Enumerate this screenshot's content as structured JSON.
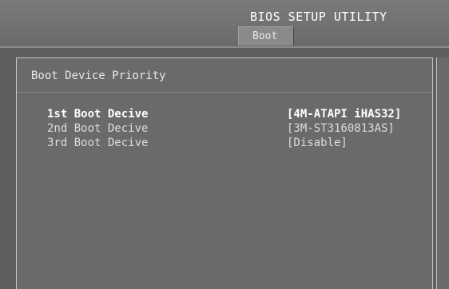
{
  "header": {
    "title": "BIOS SETUP UTILITY",
    "active_tab": "Boot"
  },
  "section": {
    "title": "Boot Device Priority"
  },
  "boot_devices": [
    {
      "label": "1st Boot Decive",
      "value": "[4M-ATAPI iHAS32]",
      "selected": true
    },
    {
      "label": "2nd Boot Decive",
      "value": "[3M-ST3160813AS]",
      "selected": false
    },
    {
      "label": "3rd Boot Decive",
      "value": "[Disable]",
      "selected": false
    }
  ],
  "colors": {
    "background": "#5f5f5f",
    "panel": "#6a6a6a",
    "border": "#c8c8c8",
    "text": "#f2f2f2"
  }
}
